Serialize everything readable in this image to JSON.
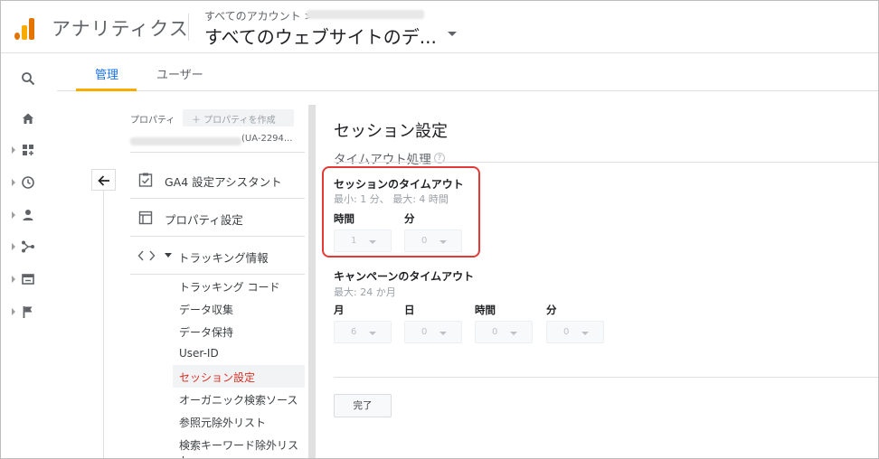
{
  "header": {
    "app_title": "アナリティクス",
    "breadcrumb": "すべてのアカウント >",
    "view_name": "すべてのウェブサイトのデ..."
  },
  "tabs": [
    {
      "label": "管理",
      "active": true
    },
    {
      "label": "ユーザー",
      "active": false
    }
  ],
  "property": {
    "label": "プロパティ",
    "create_button": "＋ プロパティを作成",
    "id_suffix": "(UA-2294..."
  },
  "nav": {
    "items": [
      {
        "label": "GA4 設定アシスタント",
        "icon": "clipboard-check-icon"
      },
      {
        "label": "プロパティ設定",
        "icon": "property-settings-icon"
      },
      {
        "label": "トラッキング情報",
        "icon": "code-brackets-icon"
      }
    ],
    "sub_items": [
      {
        "label": "トラッキング コード",
        "active": false
      },
      {
        "label": "データ収集",
        "active": false
      },
      {
        "label": "データ保持",
        "active": false
      },
      {
        "label": "User-ID",
        "active": false
      },
      {
        "label": "セッション設定",
        "active": true
      },
      {
        "label": "オーガニック検索ソース",
        "active": false
      },
      {
        "label": "参照元除外リスト",
        "active": false
      },
      {
        "label": "検索キーワード除外リスト",
        "active": false
      }
    ]
  },
  "content": {
    "title": "セッション設定",
    "section": "タイムアウト処理",
    "help_glyph": "?",
    "session_timeout": {
      "title": "セッションのタイムアウト",
      "limits": "最小: 1 分、 最大: 4 時間",
      "fields": [
        {
          "label": "時間",
          "value": "1"
        },
        {
          "label": "分",
          "value": "0"
        }
      ]
    },
    "campaign_timeout": {
      "title": "キャンペーンのタイムアウト",
      "limits": "最大: 24 か月",
      "fields": [
        {
          "label": "月",
          "value": "6"
        },
        {
          "label": "日",
          "value": "0"
        },
        {
          "label": "時間",
          "value": "0"
        },
        {
          "label": "分",
          "value": "0"
        }
      ]
    },
    "done_button": "完了"
  },
  "colors": {
    "accent": "#1a73e8",
    "tab_underline": "#f9ab00",
    "active_link": "#d93025",
    "highlight_box": "#e53935"
  }
}
